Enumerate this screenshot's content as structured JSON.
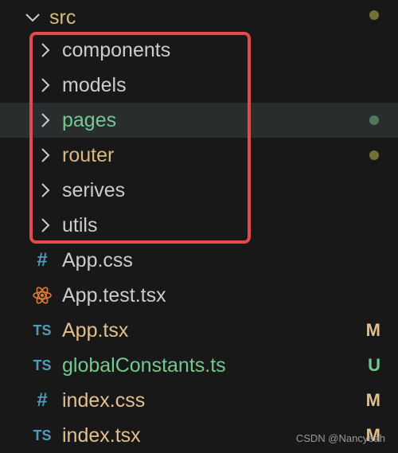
{
  "explorer": {
    "root": {
      "label": "src",
      "label_color": "#d7ba7d",
      "dot_color": "#75703a"
    },
    "folders": [
      {
        "label": "components",
        "color": "#cccccc",
        "dot": null
      },
      {
        "label": "models",
        "color": "#cccccc",
        "dot": null
      },
      {
        "label": "pages",
        "color": "#73c991",
        "dot": "#4d7a5a",
        "selected": true
      },
      {
        "label": "router",
        "color": "#d7ba7d",
        "dot": "#75703a"
      },
      {
        "label": "serives",
        "color": "#cccccc",
        "dot": null
      },
      {
        "label": "utils",
        "color": "#cccccc",
        "dot": null
      }
    ],
    "files": [
      {
        "label": "App.css",
        "icon": "hash-icon",
        "icon_text": "#",
        "color": "#cccccc",
        "badge": ""
      },
      {
        "label": "App.test.tsx",
        "icon": "react-icon",
        "icon_text": "",
        "color": "#cccccc",
        "badge": ""
      },
      {
        "label": "App.tsx",
        "icon": "typescript-icon",
        "icon_text": "TS",
        "color": "#e2c08d",
        "badge": "M"
      },
      {
        "label": "globalConstants.ts",
        "icon": "typescript-icon",
        "icon_text": "TS",
        "color": "#73c991",
        "badge": "U"
      },
      {
        "label": "index.css",
        "icon": "hash-icon",
        "icon_text": "#",
        "color": "#e2c08d",
        "badge": "M"
      },
      {
        "label": "index.tsx",
        "icon": "typescript-icon",
        "icon_text": "TS",
        "color": "#e2c08d",
        "badge": "M"
      }
    ]
  },
  "colors": {
    "highlight_border": "#e5484d",
    "react_icon": "#e37933",
    "ts_icon": "#519aba"
  },
  "watermark": "CSDN @Nancyeah"
}
